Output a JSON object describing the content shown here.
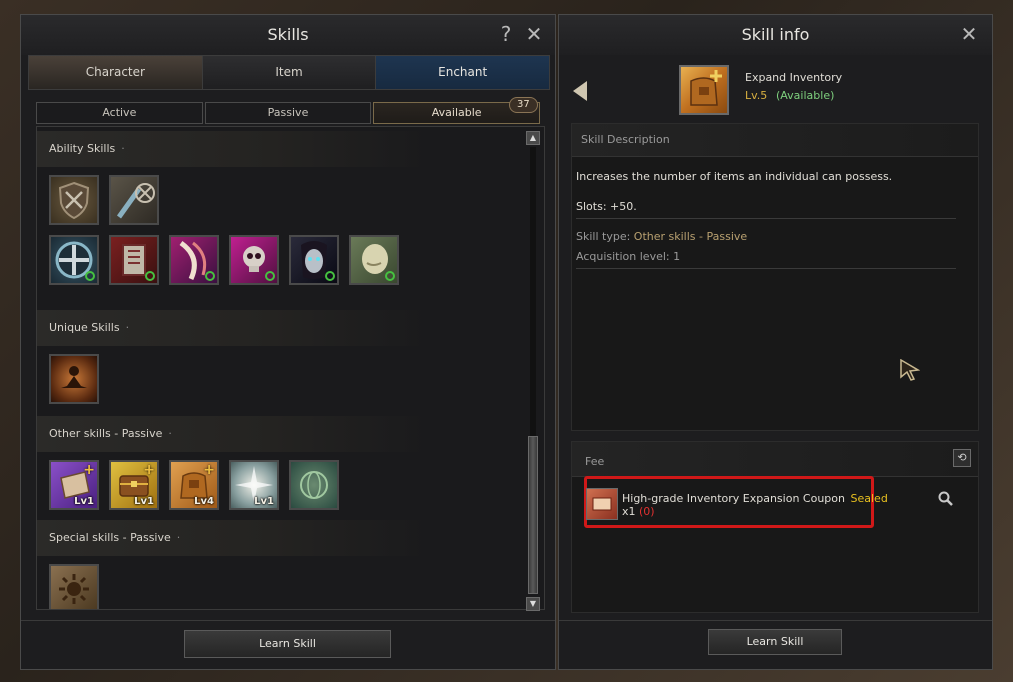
{
  "skills_window": {
    "title": "Skills",
    "help_glyph": "?",
    "close_glyph": "✕",
    "main_tabs": [
      {
        "label": "Character"
      },
      {
        "label": "Item"
      },
      {
        "label": "Enchant"
      }
    ],
    "sub_tabs": [
      {
        "label": "Active"
      },
      {
        "label": "Passive"
      },
      {
        "label": "Available"
      }
    ],
    "available_count": "37",
    "sections": {
      "ability": "Ability Skills",
      "unique": "Unique Skills",
      "other_passive": "Other skills - Passive",
      "special_passive": "Special skills - Passive"
    },
    "other_passive_levels": [
      "Lv1",
      "Lv1",
      "Lv4",
      "Lv1"
    ],
    "learn_button": "Learn Skill"
  },
  "skill_info_window": {
    "title": "Skill info",
    "close_glyph": "✕",
    "skill_name": "Expand Inventory",
    "skill_level": "Lv.5",
    "skill_status": "(Available)",
    "description_header": "Skill Description",
    "description": "Increases the number of items an individual can possess.",
    "slots": "Slots: +50.",
    "skill_type_label": "Skill type:",
    "skill_type_value": "Other skills - Passive",
    "acquisition_level": "Acquisition level: 1",
    "fee_header": "Fee",
    "fee_item_name": "High-grade Inventory Expansion Coupon",
    "fee_item_tag": "Sealed",
    "fee_item_qty": "x1",
    "fee_item_owned": "(0)",
    "learn_button": "Learn Skill"
  },
  "colors": {
    "enchant_tab": "#1e3550",
    "green_available": "#7ed07e",
    "gold_level": "#d8b040",
    "sealed": "#e8c020",
    "owned_red": "#e03030",
    "highlight_border": "#d01818"
  },
  "icons": {
    "ability_row1": [
      "shield-crossed-weapons-icon",
      "sword-shield-icon"
    ],
    "ability_row2": [
      "round-shield-icon",
      "armor-plate-icon",
      "demon-claw-icon",
      "skull-icon",
      "dark-face-icon",
      "stone-face-icon"
    ],
    "unique": [
      "meditating-figure-icon"
    ],
    "other_passive": [
      "purple-bag-icon",
      "treasure-chest-icon",
      "leather-bag-icon",
      "light-burst-icon",
      "globe-icon"
    ],
    "special_passive": [
      "sun-emblem-icon"
    ]
  }
}
